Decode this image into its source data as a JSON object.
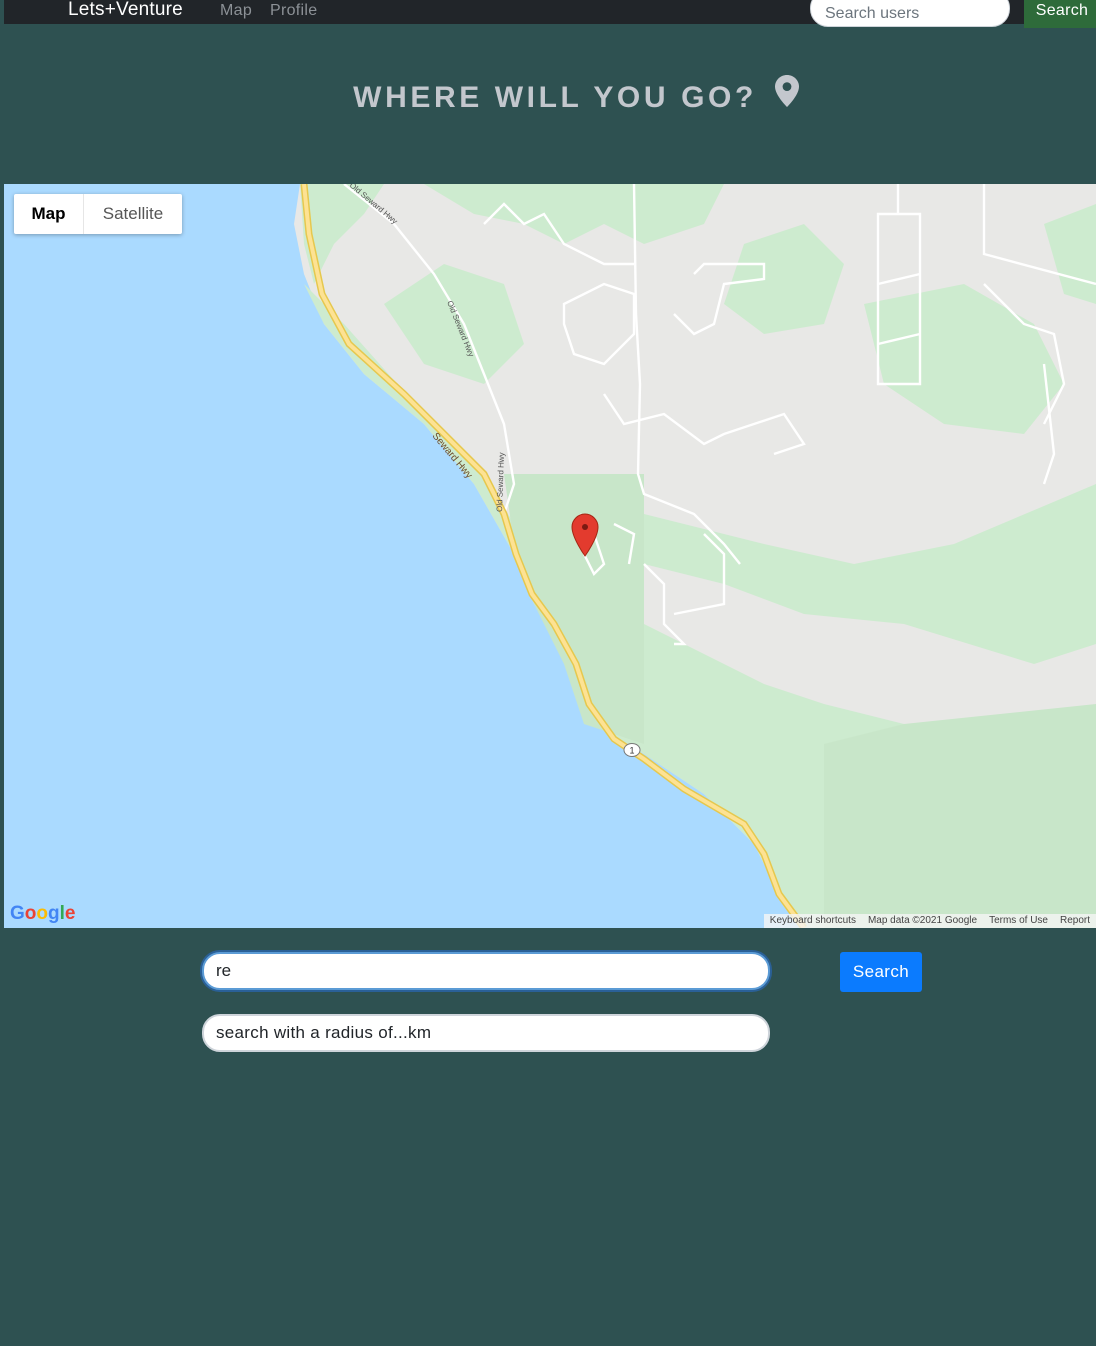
{
  "navbar": {
    "brand": "Lets+Venture",
    "links": [
      {
        "label": "Map"
      },
      {
        "label": "Profile"
      }
    ],
    "search": {
      "placeholder": "Search users",
      "value": ""
    },
    "search_button": "Search"
  },
  "headline": {
    "text": "WHERE WILL YOU GO?",
    "icon": "map-pin-icon"
  },
  "map": {
    "map_type": {
      "options": [
        "Map",
        "Satellite"
      ],
      "selected": "Map"
    },
    "road_labels": [
      "Seward Hwy",
      "Old Seward Hwy",
      "Old Seward Hwy",
      "Old Seward Hwy"
    ],
    "route_shield": "1",
    "marker_icon": "red-map-marker-icon",
    "logo": "Google",
    "attribution": [
      "Keyboard shortcuts",
      "Map data ©2021 Google",
      "Terms of Use",
      "Report"
    ],
    "colors": {
      "water": "#aadaff",
      "land": "#e8e8e6",
      "park": "#cdebcf",
      "highway": "#f5d778",
      "marker": "#e33b2e"
    }
  },
  "form": {
    "place_input": {
      "value": "re",
      "placeholder": ""
    },
    "radius_input": {
      "value": "",
      "placeholder": "search with a radius of...km"
    },
    "search_button": "Search",
    "colors": {
      "search_button": "#0b7bfe"
    }
  }
}
